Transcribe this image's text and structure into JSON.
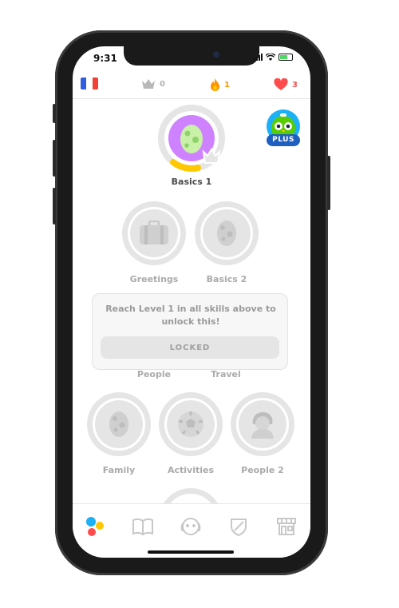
{
  "status_bar": {
    "time": "9:31"
  },
  "top_bar": {
    "course_flag": "france-flag-icon",
    "crowns": "0",
    "streak": "1",
    "hearts": "3",
    "colors": {
      "crown": "#b0b0b0",
      "streak": "#ff9600",
      "hearts": "#ff4b4b"
    }
  },
  "plus_badge": {
    "label": "PLUS"
  },
  "skills": {
    "basics1": {
      "label": "Basics 1",
      "progress": 0.2
    },
    "greetings": {
      "label": "Greetings"
    },
    "basics2": {
      "label": "Basics 2"
    },
    "people": {
      "label": "People"
    },
    "travel": {
      "label": "Travel"
    },
    "family": {
      "label": "Family"
    },
    "activities": {
      "label": "Activities"
    },
    "people2": {
      "label": "People 2"
    }
  },
  "tooltip": {
    "message": "Reach Level 1 in all skills above to unlock this!",
    "button_label": "LOCKED"
  },
  "bottom_nav": {
    "items": [
      "learn-icon",
      "stories-icon",
      "profile-icon",
      "leagues-icon",
      "shop-icon"
    ]
  },
  "colors": {
    "accent_purple": "#ce82ff",
    "progress_gold": "#ffc800",
    "locked_gray": "#e5e5e5"
  }
}
